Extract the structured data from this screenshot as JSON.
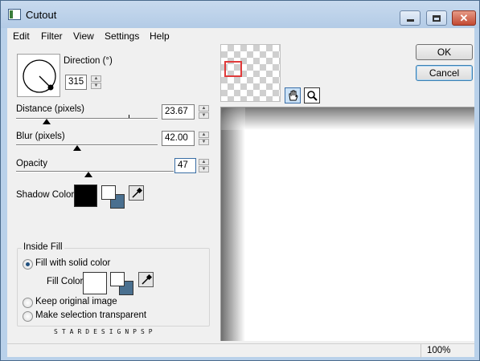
{
  "window": {
    "title": "Cutout",
    "minimize_glyph": "–",
    "close_glyph": "✕"
  },
  "menu": {
    "items": [
      {
        "label": "Edit"
      },
      {
        "label": "Filter"
      },
      {
        "label": "View"
      },
      {
        "label": "Settings"
      },
      {
        "label": "Help"
      }
    ]
  },
  "controls": {
    "direction": {
      "label": "Direction (°)",
      "value": "315"
    },
    "distance": {
      "label": "Distance (pixels)",
      "value": "23.67",
      "slider_fraction": 0.21
    },
    "blur": {
      "label": "Blur (pixels)",
      "value": "42.00",
      "slider_fraction": 0.42
    },
    "opacity": {
      "label": "Opacity",
      "value": "47",
      "slider_fraction": 0.47
    },
    "shadow_color": {
      "label": "Shadow Color",
      "color": "#000000",
      "secondary_color": "#4a7090"
    }
  },
  "inside_fill": {
    "legend": "Inside Fill",
    "options": [
      {
        "label": "Fill with solid color",
        "selected": true
      },
      {
        "label": "Keep original image",
        "selected": false
      },
      {
        "label": "Make selection transparent",
        "selected": false
      }
    ],
    "fill_color": {
      "label": "Fill Color",
      "color": "#ffffff",
      "secondary_color": "#4a7090"
    }
  },
  "watermark": "STARDESIGNPSP",
  "buttons": {
    "ok": "OK",
    "cancel": "Cancel"
  },
  "tools": {
    "pan": "hand-icon",
    "zoom": "magnifier-icon"
  },
  "status": {
    "zoom": "100%"
  },
  "colors": {
    "titlebar": "#b9d1ea",
    "accent": "#3c7fb1",
    "thumbnail_marker": "#e03a3a"
  }
}
